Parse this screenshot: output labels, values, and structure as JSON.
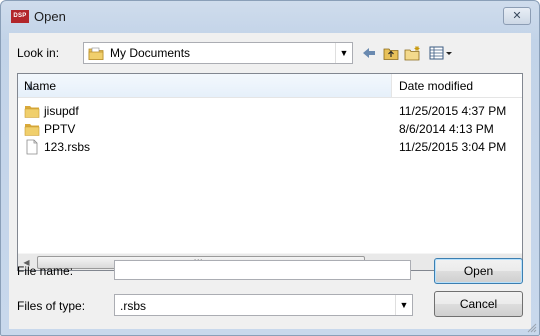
{
  "window": {
    "app_logo": "DSP",
    "title": "Open",
    "close_glyph": "✕"
  },
  "toolbar": {
    "lookin_label": "Look in:",
    "lookin_value": "My Documents",
    "buttons": {
      "back_icon": "back-arrow-icon",
      "up_icon": "up-folder-icon",
      "new_folder_icon": "new-folder-icon",
      "view_menu_icon": "view-menu-icon"
    }
  },
  "filelist": {
    "columns": {
      "name": "Name",
      "date": "Date modified"
    },
    "rows": [
      {
        "name": "jisupdf",
        "date": "11/25/2015 4:37 PM",
        "type": "folder"
      },
      {
        "name": "PPTV",
        "date": "8/6/2014 4:13 PM",
        "type": "folder"
      },
      {
        "name": "123.rsbs",
        "date": "11/25/2015 3:04 PM",
        "type": "file"
      }
    ]
  },
  "form": {
    "filename_label": "File name:",
    "filename_value": "",
    "filetype_label": "Files of type:",
    "filetype_value": ".rsbs"
  },
  "buttons": {
    "open": "Open",
    "cancel": "Cancel"
  },
  "colors": {
    "folder": "#e8c15a",
    "accent": "#3c7fb1"
  }
}
